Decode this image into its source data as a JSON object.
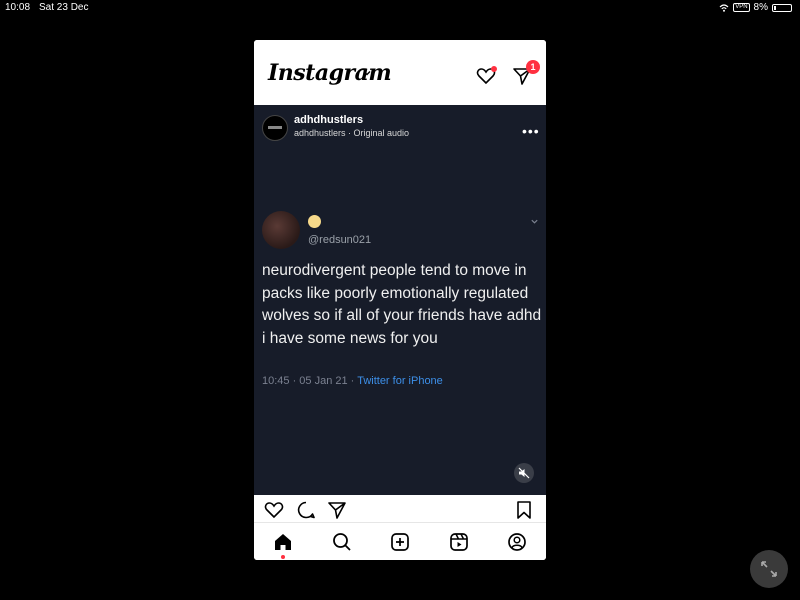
{
  "status_bar": {
    "time": "10:08",
    "date": "Sat 23 Dec",
    "vpn": "VPN",
    "battery": "8%"
  },
  "header": {
    "logo": "Instagram",
    "dm_badge": "1"
  },
  "post": {
    "username": "adhdhustlers",
    "audio": "adhdhustlers · Original audio",
    "tweet": {
      "handle": "@redsun021",
      "text": "neurodivergent people tend to move in packs like poorly emotionally regulated wolves so if all of your friends have adhd i have some news for you",
      "time": "10:45 · 05 Jan 21 · ",
      "source": "Twitter for iPhone"
    }
  },
  "icons": {
    "heart": "heart-icon",
    "comment": "comment-icon",
    "share": "share-icon",
    "bookmark": "bookmark-icon",
    "home": "home-icon",
    "search": "search-icon",
    "create": "create-icon",
    "reels": "reels-icon",
    "profile": "profile-icon"
  },
  "colors": {
    "accent_red": "#ff3040",
    "link_blue": "#3d8fe8",
    "post_bg": "#171c29"
  }
}
